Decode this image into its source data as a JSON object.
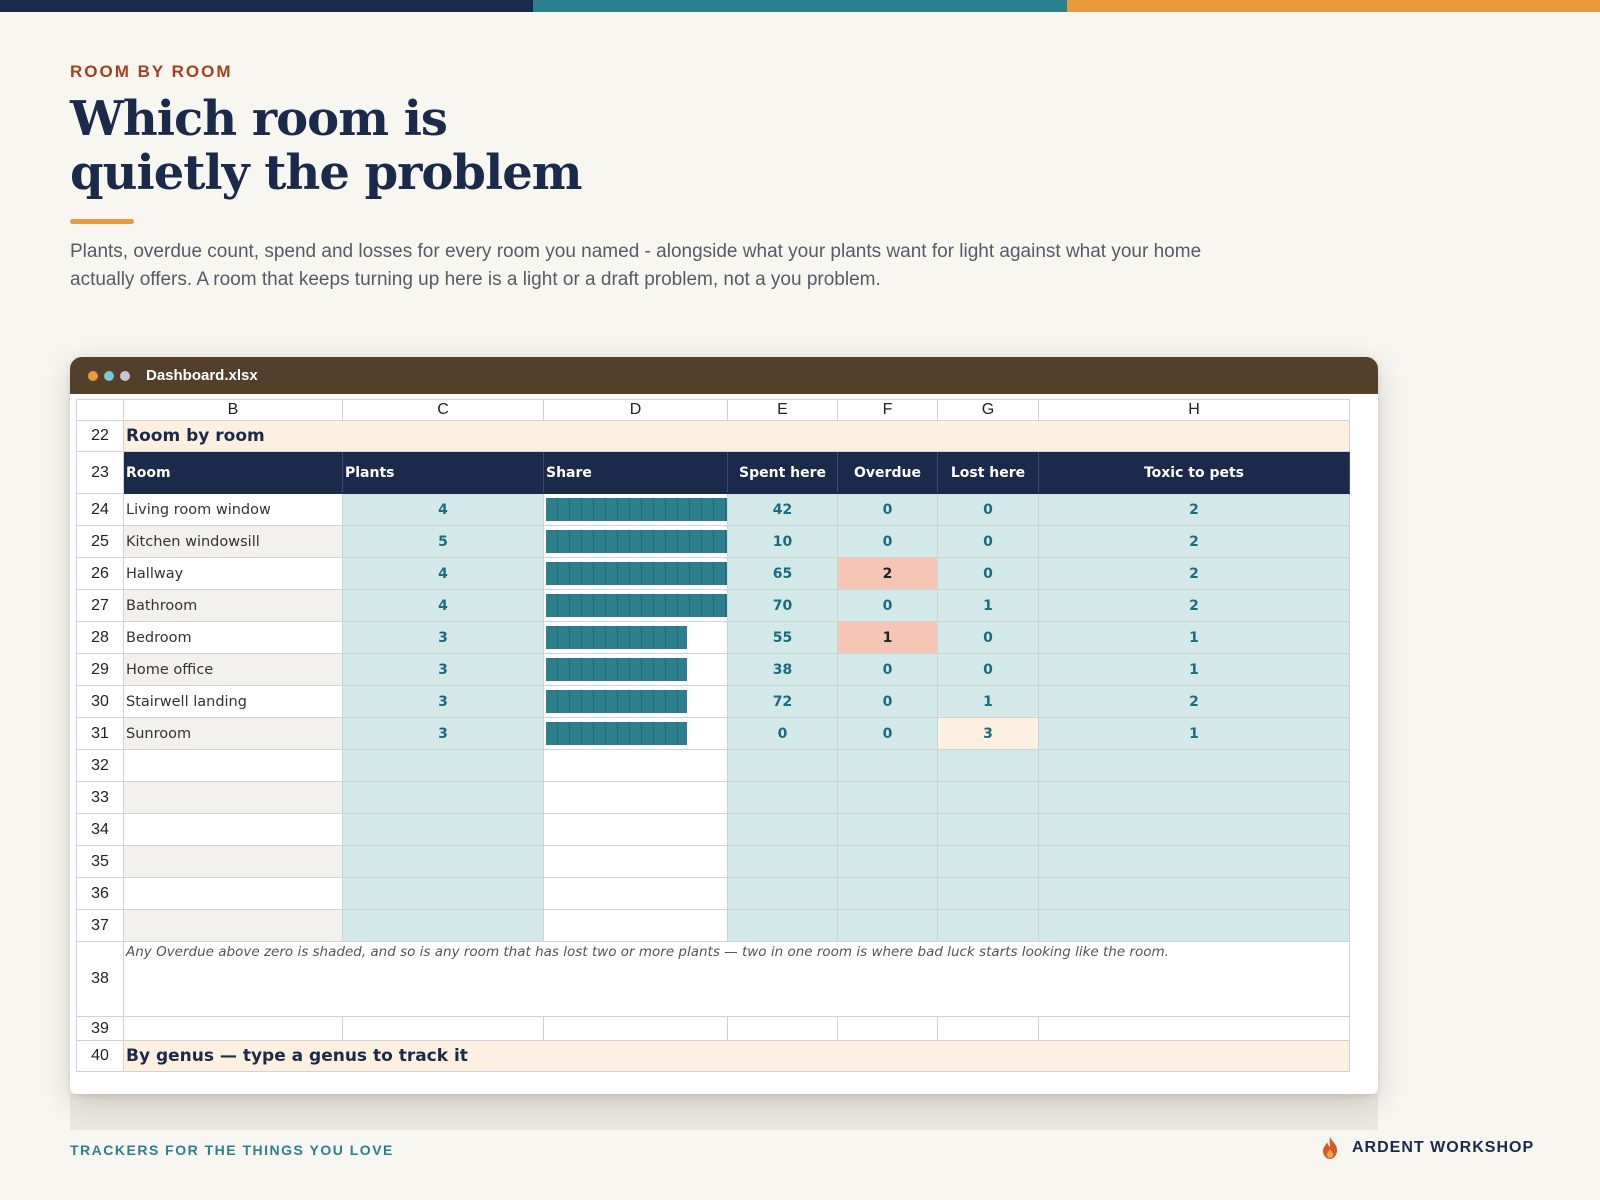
{
  "colors": {
    "navy": "#1b2a4a",
    "teal": "#2c7f8f",
    "orange": "#e89a3d",
    "rust": "#a5401d",
    "cellTeal": "#d3e8e8",
    "overdueShade": "#f5c5b5",
    "sectionBand": "#fdf0e0"
  },
  "topbar": [
    "#1b2a4a",
    "#2c7f8f",
    "#e89a3d"
  ],
  "eyebrow": "ROOM BY ROOM",
  "title_line1": "Which room is",
  "title_line2": "quietly the problem",
  "intro": "Plants, overdue count, spend and losses for every room you named - alongside what your plants want for light against what your home actually offers. A room that keeps turning up here is a light or a draft problem, not a you problem.",
  "window": {
    "filename": "Dashboard.xlsx",
    "dots": [
      "#e89a3d",
      "#7ec8cf",
      "#c8c4d8"
    ]
  },
  "sheet": {
    "columns": [
      "B",
      "C",
      "D",
      "E",
      "F",
      "G",
      "H"
    ],
    "section_title": "Room by room",
    "section_row": "22",
    "header_row": "23",
    "headers": [
      "Room",
      "Plants",
      "Share",
      "Spent here",
      "Overdue",
      "Lost here",
      "Toxic to pets"
    ],
    "share_max_plants": 5,
    "rows": [
      {
        "n": "24",
        "room": "Living room window",
        "plants": "4",
        "spent": "42",
        "overdue": "0",
        "lost": "0",
        "toxic": "2"
      },
      {
        "n": "25",
        "room": "Kitchen windowsill",
        "plants": "5",
        "spent": "10",
        "overdue": "0",
        "lost": "0",
        "toxic": "2"
      },
      {
        "n": "26",
        "room": "Hallway",
        "plants": "4",
        "spent": "65",
        "overdue": "2",
        "lost": "0",
        "toxic": "2"
      },
      {
        "n": "27",
        "room": "Bathroom",
        "plants": "4",
        "spent": "70",
        "overdue": "0",
        "lost": "1",
        "toxic": "2"
      },
      {
        "n": "28",
        "room": "Bedroom",
        "plants": "3",
        "spent": "55",
        "overdue": "1",
        "lost": "0",
        "toxic": "1"
      },
      {
        "n": "29",
        "room": "Home office",
        "plants": "3",
        "spent": "38",
        "overdue": "0",
        "lost": "0",
        "toxic": "1"
      },
      {
        "n": "30",
        "room": "Stairwell landing",
        "plants": "3",
        "spent": "72",
        "overdue": "0",
        "lost": "1",
        "toxic": "2"
      },
      {
        "n": "31",
        "room": "Sunroom",
        "plants": "3",
        "spent": "0",
        "overdue": "0",
        "lost": "3",
        "toxic": "1"
      }
    ],
    "empty_rows": [
      "32",
      "33",
      "34",
      "35",
      "36",
      "37"
    ],
    "note_row": "38",
    "note": "Any Overdue above zero is shaded, and so is any room that has lost two or more plants — two in one room is where bad luck starts looking like the room.",
    "blank_row": "39",
    "next_section_row": "40",
    "next_section_title": "By genus — type a genus to track it"
  },
  "footer": {
    "tagline": "TRACKERS FOR THE THINGS YOU LOVE",
    "brand": "ARDENT WORKSHOP",
    "brand_icon": "flame-icon"
  }
}
